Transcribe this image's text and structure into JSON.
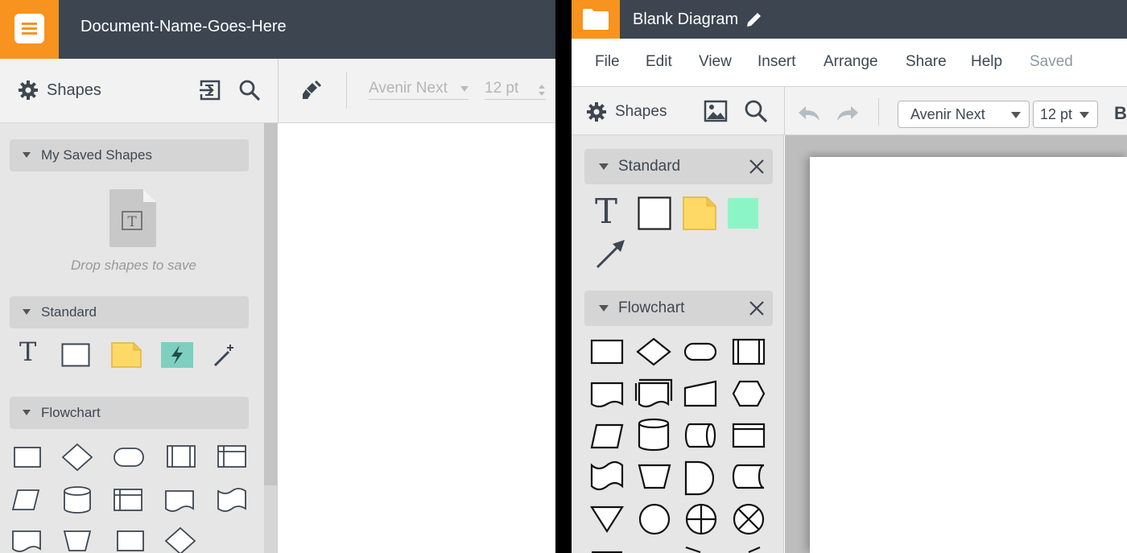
{
  "left": {
    "document_name": "Document-Name-Goes-Here",
    "shapes_label": "Shapes",
    "font_name": "Avenir Next",
    "font_size": "12 pt",
    "sections": {
      "saved": "My Saved Shapes",
      "standard": "Standard",
      "flowchart": "Flowchart"
    },
    "drop_text": "Drop shapes to save",
    "text_glyph": "T"
  },
  "right": {
    "diagram_name": "Blank Diagram",
    "menu": [
      "File",
      "Edit",
      "View",
      "Insert",
      "Arrange",
      "Share",
      "Help"
    ],
    "status": "Saved",
    "shapes_label": "Shapes",
    "font_name": "Avenir Next",
    "font_size": "12 pt",
    "bold_glyph": "B",
    "sections": {
      "standard": "Standard",
      "flowchart": "Flowchart"
    },
    "text_glyph": "T"
  },
  "colors": {
    "header": "#3c4550",
    "accent_orange": "#f7931e",
    "note_yellow": "#ffd966",
    "teal": "#7ecfc0",
    "mint": "#8cf5c7"
  }
}
